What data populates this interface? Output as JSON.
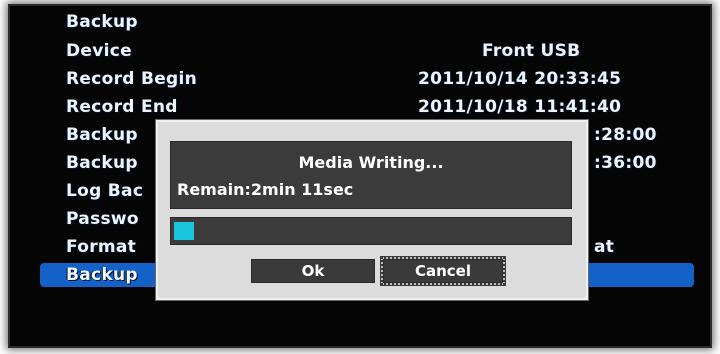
{
  "menu": {
    "items": [
      {
        "label": "Backup",
        "value": ""
      },
      {
        "label": "Device",
        "value": "Front USB"
      },
      {
        "label": "Record Begin",
        "value": "2011/10/14 20:33:45"
      },
      {
        "label": "Record End",
        "value": "2011/10/18 11:41:40"
      },
      {
        "label": "Backup",
        "value": ":28:00"
      },
      {
        "label": "Backup",
        "value": ":36:00"
      },
      {
        "label": "Log Bac",
        "value": ""
      },
      {
        "label": "Passwo",
        "value": ""
      },
      {
        "label": "Format",
        "value": "at"
      },
      {
        "label": "Backup",
        "value": ""
      }
    ],
    "selected_index": 9,
    "selection_color": "#1461c8"
  },
  "dialog": {
    "title": "Media Writing...",
    "remain": "Remain:2min 11sec",
    "progress_fraction": 0.05,
    "progress_color": "#19c6dd",
    "ok_label": "Ok",
    "cancel_label": "Cancel",
    "focused_button": "cancel"
  }
}
